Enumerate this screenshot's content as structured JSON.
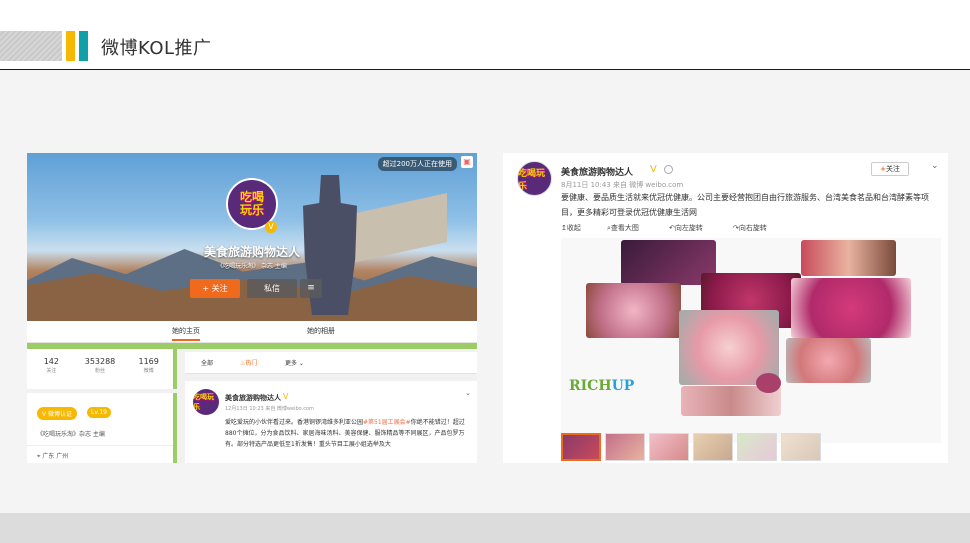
{
  "slide": {
    "title": "微博KOL推广"
  },
  "left": {
    "cover_badge": "超过200万人正在使用",
    "nickname": "美食旅游购物达人",
    "subtitle": "《吃喝玩乐淘》 杂志 主编",
    "follow_label": "+ 关注",
    "message_label": "私信",
    "more_label": "≡",
    "tabs": [
      "她的主页",
      "她的相册"
    ],
    "stats": [
      {
        "num": "142",
        "label": "关注"
      },
      {
        "num": "353288",
        "label": "粉丝"
      },
      {
        "num": "1169",
        "label": "微博"
      }
    ],
    "verified_badge": "V 微博认证",
    "level_badge": "Lv.19",
    "profile_desc": "《吃喝玩乐淘》杂志 主编",
    "location": "广东 广州",
    "feed_tabs": [
      "全部",
      "热门",
      "更多"
    ],
    "post": {
      "name": "美食旅游购物达人",
      "meta": "12月13日 10:23 来自 微博weibo.com",
      "text_before": "爱吃爱玩的小伙伴看过来。香港铜锣湾维多利亚公园",
      "topic": "#第51届工展会#",
      "text_after": "你绝不能错过！超过880个摊位，分为食品饮料、家居海味汤料、美容保健、服饰精品等不同展区，产品包罗万有。部分特选产品更低至1折发售！重头节目工展小姐选举及大"
    }
  },
  "right": {
    "name": "美食旅游购物达人",
    "meta": "8月11日 10:43 来自 微博 weibo.com",
    "follow_label": "关注",
    "text": "要健康、要品质生活就来优冠优健康。公司主要经营抱团自由行旅游服务、台湾美食茗品和台湾酵素等项目，更多精彩可登录优冠优健康生活网",
    "actions": [
      "收起",
      "查看大图",
      "向左旋转",
      "向右旋转"
    ],
    "logo": {
      "rich": "RICH",
      "up": "UP"
    }
  },
  "colors": {
    "accent": "#f06a1e",
    "green": "#9ccc65",
    "gold": "#f6b800",
    "teal": "#12a0a8"
  }
}
